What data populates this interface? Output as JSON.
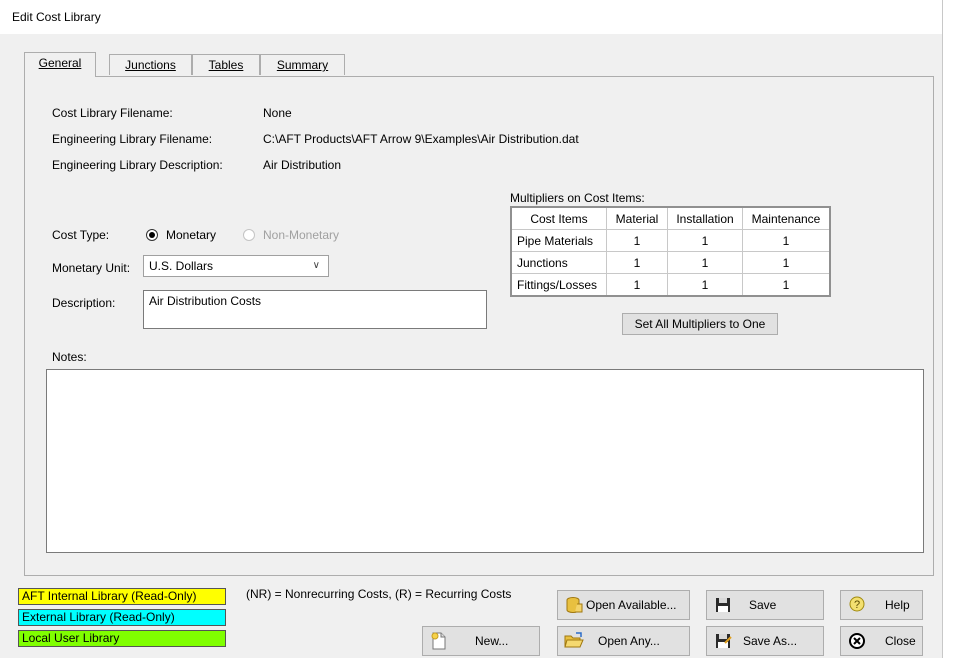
{
  "window": {
    "title": "Edit Cost Library"
  },
  "tabs": [
    {
      "label": "General",
      "active": true
    },
    {
      "label": "Junctions",
      "active": false
    },
    {
      "label": "Tables",
      "active": false
    },
    {
      "label": "Summary",
      "active": false
    }
  ],
  "general": {
    "cost_library_filename_label": "Cost Library Filename:",
    "cost_library_filename_value": "None",
    "engineering_library_filename_label": "Engineering Library Filename:",
    "engineering_library_filename_value": "C:\\AFT Products\\AFT Arrow 9\\Examples\\Air Distribution.dat",
    "engineering_library_description_label": "Engineering Library Description:",
    "engineering_library_description_value": "Air Distribution",
    "cost_type_label": "Cost Type:",
    "cost_type_options": [
      {
        "label": "Monetary",
        "checked": true,
        "enabled": true
      },
      {
        "label": "Non-Monetary",
        "checked": false,
        "enabled": false
      }
    ],
    "monetary_unit_label": "Monetary Unit:",
    "monetary_unit_value": "U.S. Dollars",
    "description_label": "Description:",
    "description_value": "Air Distribution Costs",
    "notes_label": "Notes:",
    "notes_value": ""
  },
  "multipliers": {
    "title": "Multipliers on Cost Items:",
    "headers": [
      "Cost Items",
      "Material",
      "Installation",
      "Maintenance"
    ],
    "rows": [
      [
        "Pipe Materials",
        "1",
        "1",
        "1"
      ],
      [
        "Junctions",
        "1",
        "1",
        "1"
      ],
      [
        "Fittings/Losses",
        "1",
        "1",
        "1"
      ]
    ],
    "set_all_label": "Set All Multipliers to One"
  },
  "legend": {
    "internal": {
      "label": "AFT Internal Library (Read-Only)",
      "color": "#ffff00"
    },
    "external": {
      "label": "External Library (Read-Only)",
      "color": "#00ffff"
    },
    "local": {
      "label": "Local User Library",
      "color": "#80ff00"
    },
    "cost_note": "(NR) = Nonrecurring Costs, (R) = Recurring Costs"
  },
  "buttons": {
    "new": "New...",
    "open_available": "Open Available...",
    "open_any": "Open Any...",
    "save": "Save",
    "save_as": "Save As...",
    "help": "Help",
    "close": "Close"
  }
}
